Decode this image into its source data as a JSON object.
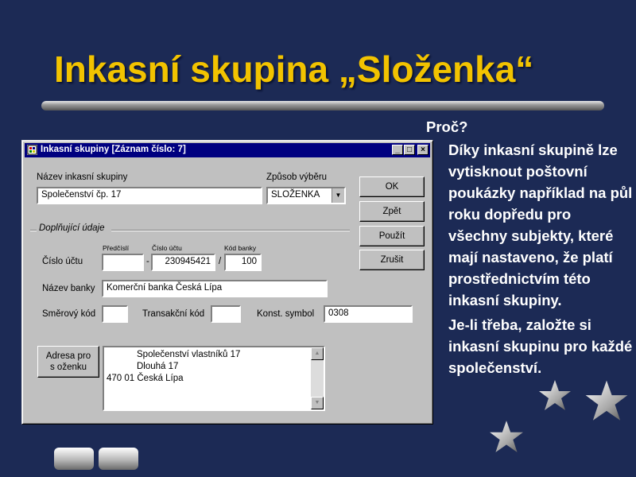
{
  "slide": {
    "title": "Inkasní skupina „Složenka“",
    "question": "Proč?",
    "paragraphs": [
      "Díky inkasní skupině lze vytisknout poštovní poukázky například na půl roku dopředu pro všechny subjekty, které mají nastaveno, že platí prostřednictvím této inkasní skupiny.",
      "Je-li třeba, založte si inkasní skupinu pro každé společenství."
    ]
  },
  "dialog": {
    "title": "Inkasní skupiny  [Záznam číslo: 7]",
    "window_buttons": {
      "minimize": "_",
      "maximize": "□",
      "close": "×"
    },
    "name_label": "Název inkasní skupiny",
    "name_value": "Společenství čp. 17",
    "method_label": "Způsob výběru",
    "method_value": "SLOŽENKA",
    "group_label": "Doplňující údaje",
    "account_label": "Číslo účtu",
    "prefix_label": "Předčíslí",
    "number_label": "Číslo účtu",
    "bank_code_label": "Kód banky",
    "prefix_value": "",
    "dash": "-",
    "number_value": "230945421",
    "slash": "/",
    "bank_code_value": "100",
    "bank_name_label": "Název banky",
    "bank_name_value": "Komerční banka Česká Lípa",
    "routing_label": "Směrový kód",
    "routing_value": "",
    "transaction_label": "Transakční kód",
    "transaction_value": "",
    "const_symbol_label": "Konst. symbol",
    "const_symbol_value": "0308",
    "address_button": [
      "Adresa pro",
      "s oženku"
    ],
    "address_lines": [
      "Společenství vlastníků 17",
      "Dlouhá 17",
      "470 01 Česká Lípa"
    ],
    "buttons": {
      "ok": "OK",
      "back": "Zpět",
      "apply": "Použít",
      "cancel": "Zrušit"
    }
  }
}
